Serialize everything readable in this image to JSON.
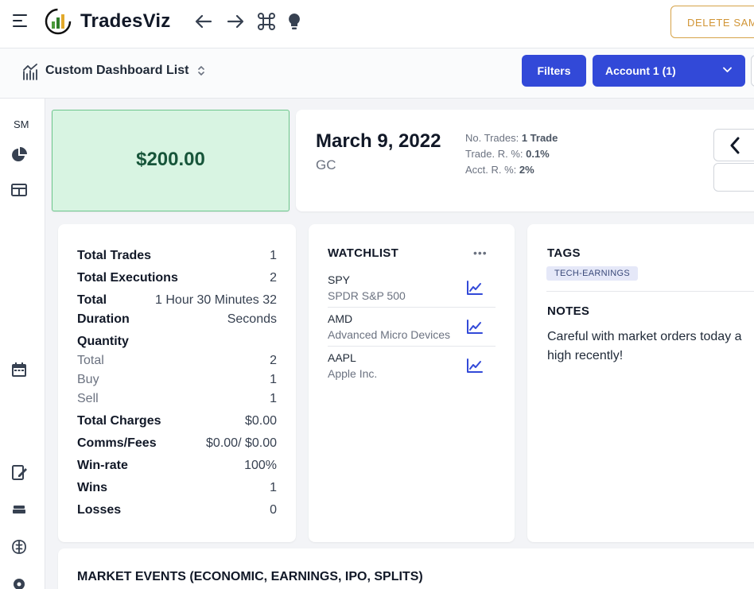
{
  "header": {
    "brand": "TradesViz",
    "delete_label": "DELETE SAM",
    "icons": [
      "menu-icon",
      "logo-icon",
      "back-arrow-icon",
      "forward-arrow-icon",
      "command-icon",
      "lightbulb-icon"
    ]
  },
  "subbar": {
    "dashboard_title": "Custom Dashboard List",
    "filters_label": "Filters",
    "account_label": "Account 1 (1)"
  },
  "sidebar": {
    "initials": "SM"
  },
  "pnl": {
    "value": "$200.00"
  },
  "day": {
    "date": "March 9, 2022",
    "symbol": "GC",
    "trades_label": "No. Trades:",
    "trades_value": "1 Trade",
    "trade_r_label": "Trade. R. %:",
    "trade_r_value": "0.1%",
    "acct_r_label": "Acct. R. %:",
    "acct_r_value": "2%"
  },
  "stats": {
    "total_trades": {
      "label": "Total Trades",
      "value": "1"
    },
    "total_executions": {
      "label": "Total Executions",
      "value": "2"
    },
    "total_duration": {
      "label_line1": "Total",
      "label_line2": "Duration",
      "value_line1": "1 Hour 30 Minutes 32",
      "value_line2": "Seconds"
    },
    "quantity": {
      "label": "Quantity"
    },
    "qty_total": {
      "label": "Total",
      "value": "2"
    },
    "qty_buy": {
      "label": "Buy",
      "value": "1"
    },
    "qty_sell": {
      "label": "Sell",
      "value": "1"
    },
    "total_charges": {
      "label": "Total Charges",
      "value": "$0.00"
    },
    "comms_fees": {
      "label": "Comms/Fees",
      "value": "$0.00/ $0.00"
    },
    "win_rate": {
      "label": "Win-rate",
      "value": "100%"
    },
    "wins": {
      "label": "Wins",
      "value": "1"
    },
    "losses": {
      "label": "Losses",
      "value": "0"
    }
  },
  "watchlist": {
    "title": "WATCHLIST",
    "menu": "•••",
    "items": [
      {
        "symbol": "SPY",
        "name": "SPDR S&P 500"
      },
      {
        "symbol": "AMD",
        "name": "Advanced Micro Devices"
      },
      {
        "symbol": "AAPL",
        "name": "Apple Inc."
      }
    ]
  },
  "tags": {
    "title": "TAGS",
    "items": [
      "TECH-EARNINGS"
    ]
  },
  "notes": {
    "title": "NOTES",
    "line1": "Careful with market orders today a",
    "line2": "high recently!"
  },
  "events": {
    "title": "MARKET EVENTS (ECONOMIC, EARNINGS, IPO, SPLITS)"
  },
  "colors": {
    "primary": "#3249d8",
    "pnl_bg": "#d8f4e2",
    "pnl_text": "#17553a",
    "warning": "#d19536"
  }
}
